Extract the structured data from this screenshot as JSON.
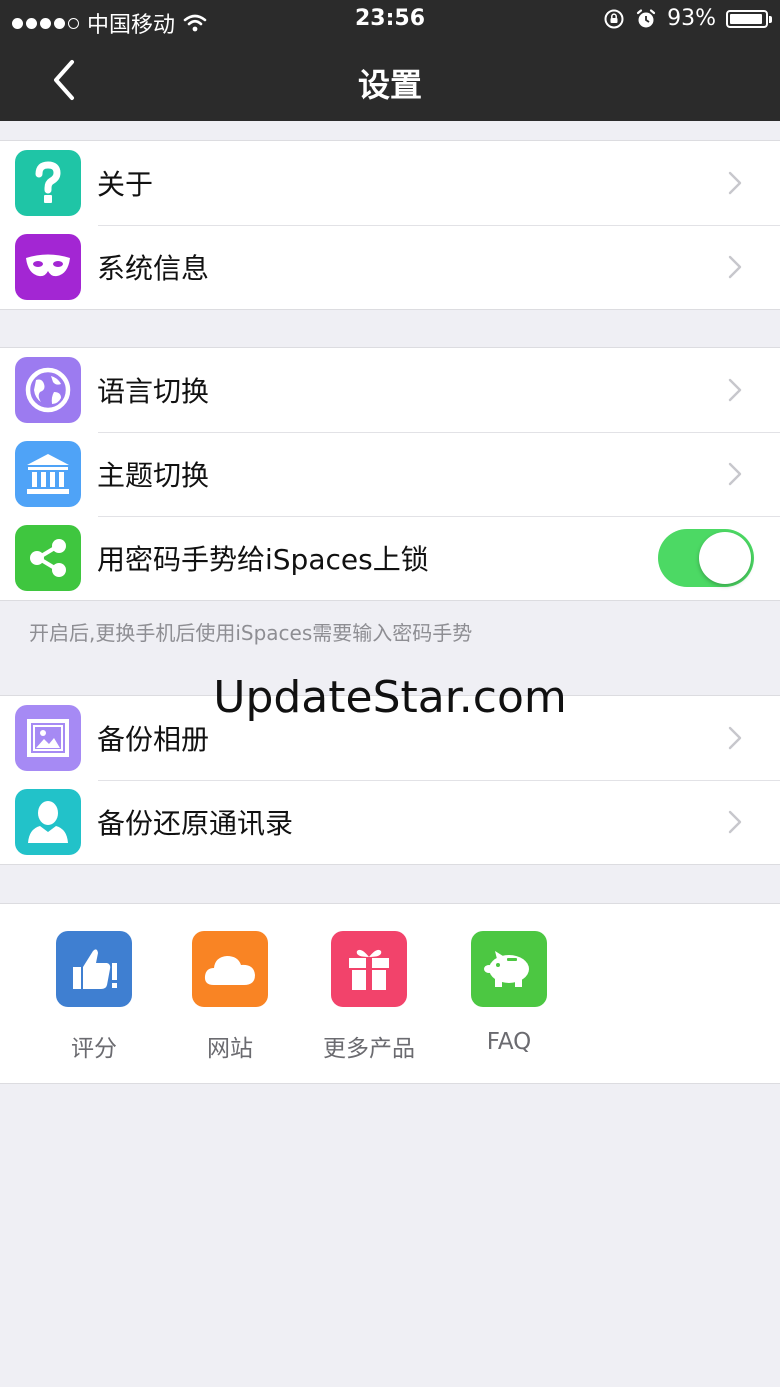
{
  "status_bar": {
    "carrier": "中国移动",
    "time": "23:56",
    "battery": "93%",
    "battery_level": 0.93,
    "signal_bars": 4
  },
  "nav": {
    "title": "设置"
  },
  "group1": [
    {
      "label": "关于",
      "icon": "question-icon",
      "color": "#1fc5a6"
    },
    {
      "label": "系统信息",
      "icon": "mask-icon",
      "color": "#a326d3"
    }
  ],
  "group2": [
    {
      "label": "语言切换",
      "icon": "globe-icon",
      "color": "#9c7bf0"
    },
    {
      "label": "主题切换",
      "icon": "bank-icon",
      "color": "#4fa3f7"
    },
    {
      "label": "用密码手势给iSpaces上锁",
      "icon": "share-icon",
      "color": "#3fc63f",
      "toggle_on": true
    }
  ],
  "group2_note": "开启后,更换手机后使用iSpaces需要输入密码手势",
  "watermark": "UpdateStar.com",
  "group3": [
    {
      "label": "备份相册",
      "icon": "picture-icon",
      "color": "#a68af4"
    },
    {
      "label": "备份还原通讯录",
      "icon": "contact-icon",
      "color": "#22c2c9"
    }
  ],
  "tiles": [
    {
      "label": "评分",
      "icon": "thumbs-up-icon",
      "color": "#3f7fd1"
    },
    {
      "label": "网站",
      "icon": "cloud-icon",
      "color": "#f98424"
    },
    {
      "label": "更多产品",
      "icon": "gift-icon",
      "color": "#f2436b"
    },
    {
      "label": "FAQ",
      "icon": "piggy-bank-icon",
      "color": "#4cc742"
    }
  ]
}
